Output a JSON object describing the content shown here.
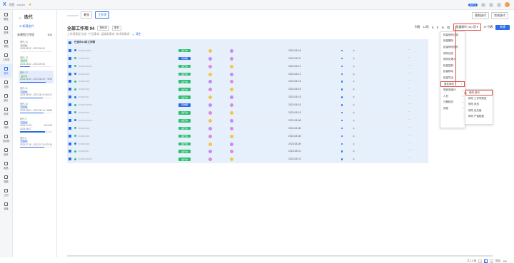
{
  "topbar": {
    "logo": "X",
    "crumb1": "项目",
    "crumb2": "••••••••"
  },
  "topright": {
    "badge": "BETA"
  },
  "leftnav": [
    "概览",
    "需求",
    "缺陷",
    "工作项",
    "迭代",
    "文档",
    "统计",
    "测试",
    "代码",
    "流水线",
    "版本",
    "制品",
    "效能",
    "工时",
    "设置"
  ],
  "iter": {
    "title": "迭代",
    "new": "新建迭代",
    "planned_label": "未规划工作项",
    "planned_count": "104",
    "cards": [
      {
        "name": "迭代 14",
        "status": "未开始",
        "status_kind": "gray",
        "dates": "2023.08.22 - 2023.09.04",
        "count": "",
        "progress": 0,
        "sel": false
      },
      {
        "name": "迭代 13",
        "status": "进行中",
        "status_kind": "green",
        "dates": "2023.08.22 - 2023.09.04",
        "count": "",
        "progress": 0.3,
        "sel": false
      },
      {
        "name": "迭代 12",
        "status": "进行中",
        "status_kind": "green",
        "dates": "2023.08.15 - 2023.08.28",
        "count": "75/94",
        "progress": 0.8,
        "sel": true
      },
      {
        "name": "迭代 11",
        "status": "已完成",
        "status_kind": "blue",
        "dates": "2023.08.08 - 2023.08.21",
        "count": "90/127",
        "progress": 0.71,
        "sel": false
      },
      {
        "name": "迭代 10",
        "status": "已完成",
        "status_kind": "blue",
        "dates": "2023.08.01 - 2023.08.14",
        "count": "59/80",
        "progress": 0.74,
        "sel": false
      },
      {
        "name": "迭代 9",
        "status": "已完成",
        "status_kind": "blue",
        "dates": "2023.07.25 - 2023.08.07",
        "count": "101/129",
        "progress": 0.78,
        "sel": false
      },
      {
        "name": "迭代 8",
        "status": "已完成",
        "status_kind": "blue",
        "dates": "2023.07.18 - 2023.07.31",
        "count": "87/115",
        "progress": 0.76,
        "sel": false
      }
    ]
  },
  "header": {
    "tab1": "概览",
    "tab2": "工作项",
    "btn1": "规划迭代",
    "btn2": "完成迭代"
  },
  "toolbar": {
    "title": "全部工作项 94",
    "chip1": "按状态",
    "chip2": "更多",
    "view": "列表",
    "count": "12项",
    "bulk": "批量操作 (14) 项",
    "per": "37 列表",
    "new": "新建"
  },
  "filter": {
    "text": "工作项类型 包含 \"产品需求, 运维类需求, 技术类需求\"",
    "clear": "清空"
  },
  "group_row": "已选中14条工作项",
  "rows": [
    {
      "title": "•••••••••••••••",
      "warn": "",
      "status": "进行中",
      "status_kind": "green",
      "date": "2023-08-16"
    },
    {
      "title": "•••••••••••••",
      "warn": "",
      "status": "待排期",
      "status_kind": "blue",
      "date": "2023-08-22"
    },
    {
      "title": "••••••••••••••••",
      "warn": "",
      "status": "进行中",
      "status_kind": "green",
      "date": "2023-08-21"
    },
    {
      "title": "•••••••••••••",
      "warn": "",
      "status": "进行中",
      "status_kind": "green",
      "date": "2023-08-21"
    },
    {
      "title": "•••••••••••••",
      "warn": "",
      "status": "进行中",
      "status_kind": "green",
      "date": "2023-08-15"
    },
    {
      "title": "•••••••••••••",
      "warn": "",
      "status": "进行中",
      "status_kind": "green",
      "date": "2023-08-15"
    },
    {
      "title": "••••••••••••",
      "warn": "",
      "status": "进行中",
      "status_kind": "green",
      "date": "2023-08-15"
    },
    {
      "title": "••••••••••••••••",
      "warn": "",
      "status": "待排期",
      "status_kind": "blue",
      "date": "2023-08-15"
    },
    {
      "title": "•••••••••••••",
      "warn": "",
      "status": "进行中",
      "status_kind": "green",
      "date": "2023-08-15"
    },
    {
      "title": "••••••••••••••••",
      "warn": "",
      "status": "进行中",
      "status_kind": "green",
      "date": "2023-08-08"
    },
    {
      "title": "•••••••••••••",
      "warn": "",
      "status": "进行中",
      "status_kind": "green",
      "date": "2023-08-08"
    },
    {
      "title": "•••••••••••••",
      "warn": "",
      "status": "进行中",
      "status_kind": "green",
      "date": "2023-08-08"
    },
    {
      "title": "•••••••••••••",
      "warn": "",
      "status": "进行中",
      "status_kind": "green",
      "date": "2023-08-08"
    },
    {
      "title": "••••••••••••",
      "warn": "",
      "status": "进行中",
      "status_kind": "green",
      "date": "2023-08-01"
    },
    {
      "title": "••••••••••••••••",
      "warn": "",
      "status": "进行中",
      "status_kind": "green",
      "date": "2023-08-01"
    }
  ],
  "menu": [
    "批量操作记录",
    "批量删除",
    "批量修改迭代",
    "修改状态",
    "修改处理人",
    "批量复制",
    "批量移动",
    "批量导出",
    "属性修改",
    "规划到迭代",
    "人员",
    "日期相关",
    "其他"
  ],
  "submenu": [
    "修改 迭代 ",
    "修改 工作项类型",
    "修改 状态",
    "修改 优先级",
    "修改 严重程度"
  ],
  "footer": {
    "total": "共 14 条",
    "page": "1",
    "size": "100",
    "jump": "跳至"
  }
}
